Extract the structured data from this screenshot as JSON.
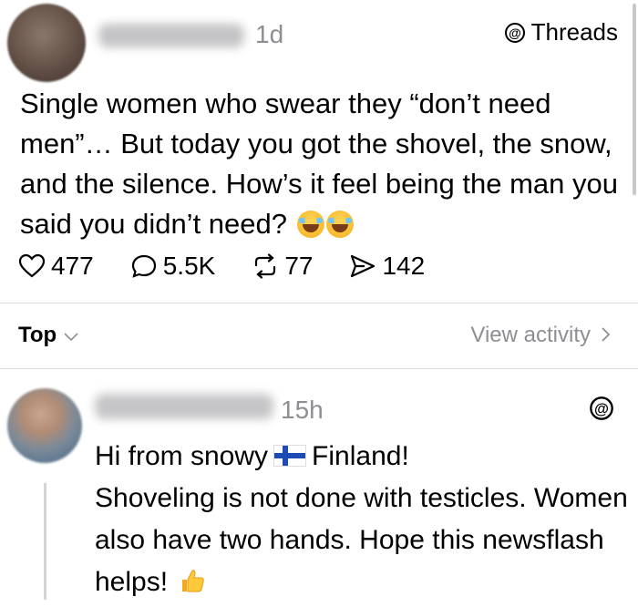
{
  "post": {
    "time": "1d",
    "brand": "Threads",
    "text": "Single women who swear they “don’t need men”… But today you got the shovel, the snow, and the silence. How’s it feel being the man you said you didn’t need?",
    "emojis": [
      "face-with-tears-of-joy",
      "face-with-tears-of-joy"
    ],
    "stats": {
      "likes": "477",
      "replies": "5.5K",
      "reposts": "77",
      "shares": "142"
    }
  },
  "sort": {
    "label": "Top"
  },
  "activity": {
    "label": "View activity"
  },
  "reply": {
    "time": "15h",
    "text_before_flag": "Hi from snowy",
    "text_after_flag": "Finland!",
    "text_rest": "Shoveling is not done with testicles. Women also have two hands. Hope this newsflash helps!",
    "flag": "finland-flag",
    "end_emoji": "thumbs-up"
  },
  "colors": {
    "secondary_text": "#8e8e93",
    "divider": "#dcdcdc",
    "text": "#000000"
  }
}
